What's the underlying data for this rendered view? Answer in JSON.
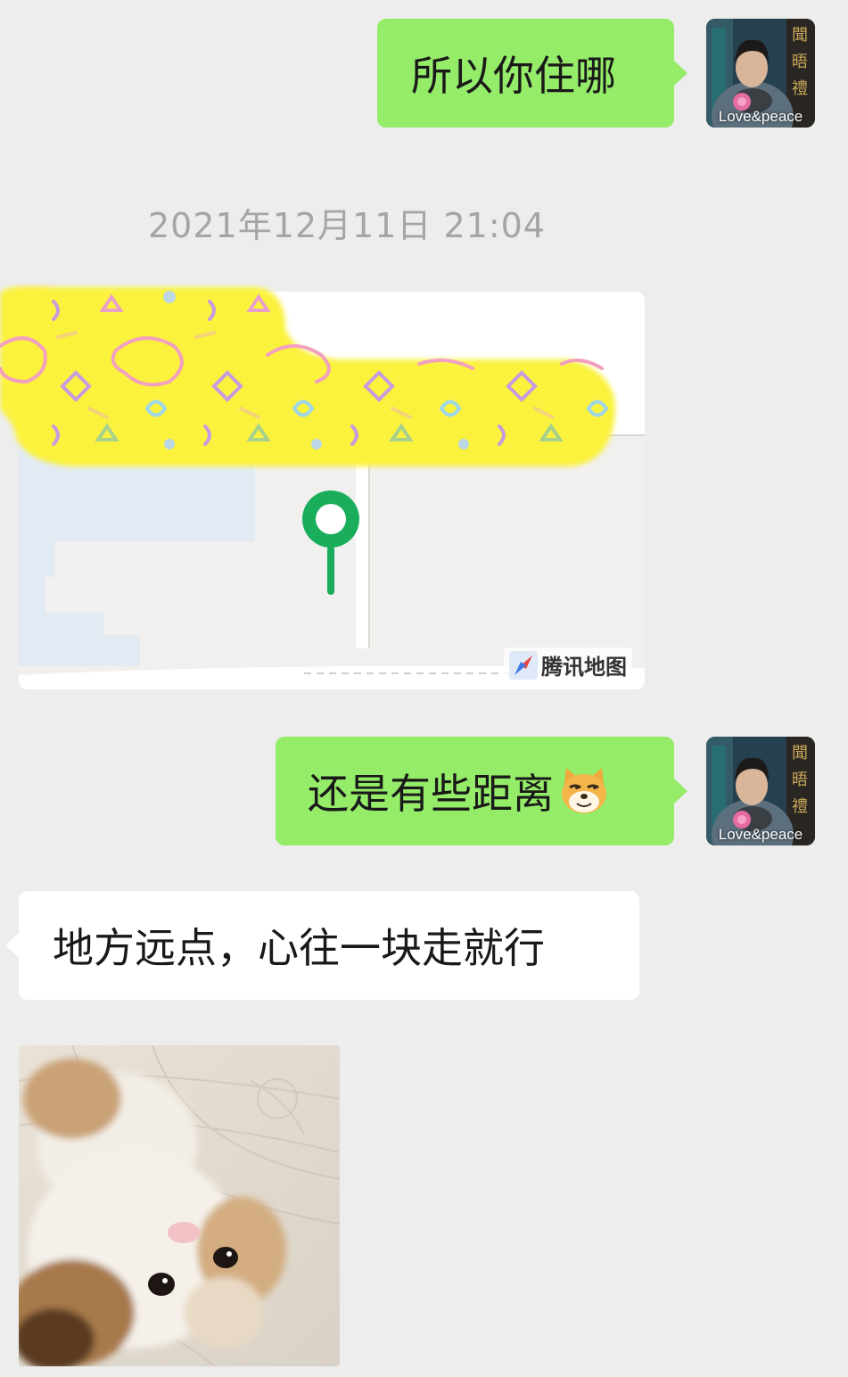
{
  "chat": {
    "messages": [
      {
        "direction": "sent",
        "type": "text",
        "text": "所以你住哪"
      },
      {
        "type": "timestamp",
        "text": "2021年12月11日 21:04"
      },
      {
        "direction": "received",
        "type": "location",
        "map_provider": "腾讯地图"
      },
      {
        "direction": "sent",
        "type": "text",
        "text": "还是有些距离",
        "emoji": "doge-face-icon"
      },
      {
        "direction": "received",
        "type": "text",
        "text": "地方远点，心往一块走就行"
      },
      {
        "direction": "received",
        "type": "image",
        "image": "kitten-photo"
      }
    ],
    "self_avatar": {
      "caption": "Love&peace",
      "side_text": "聞 晤 禮"
    }
  },
  "colors": {
    "background": "#ededed",
    "sent_bubble": "#95ec69",
    "received_bubble": "#ffffff",
    "timestamp_text": "#a5a5a5",
    "map_pin": "#1aad5c",
    "sticker_yellow": "#fbf23c"
  }
}
